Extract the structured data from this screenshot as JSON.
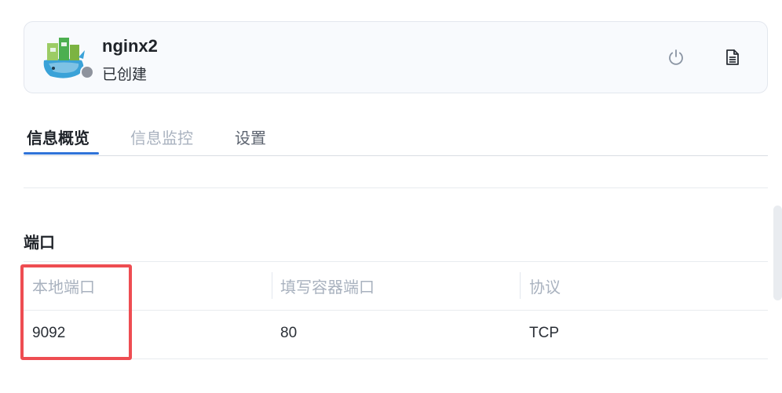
{
  "app": {
    "name": "nginx2",
    "status": "已创建"
  },
  "header_actions": {
    "power_icon": "power-icon",
    "log_icon": "document-icon"
  },
  "tabs": [
    {
      "label": "信息概览",
      "active": true
    },
    {
      "label": "信息监控",
      "active": false
    },
    {
      "label": "设置",
      "active": false
    }
  ],
  "ports": {
    "title": "端口",
    "columns": [
      "本地端口",
      "填写容器端口",
      "协议"
    ],
    "rows": [
      [
        "9092",
        "80",
        "TCP"
      ]
    ]
  },
  "colors": {
    "accent": "#2f73d9",
    "highlight": "#ee4d52",
    "status_dot": "#8e939d"
  }
}
